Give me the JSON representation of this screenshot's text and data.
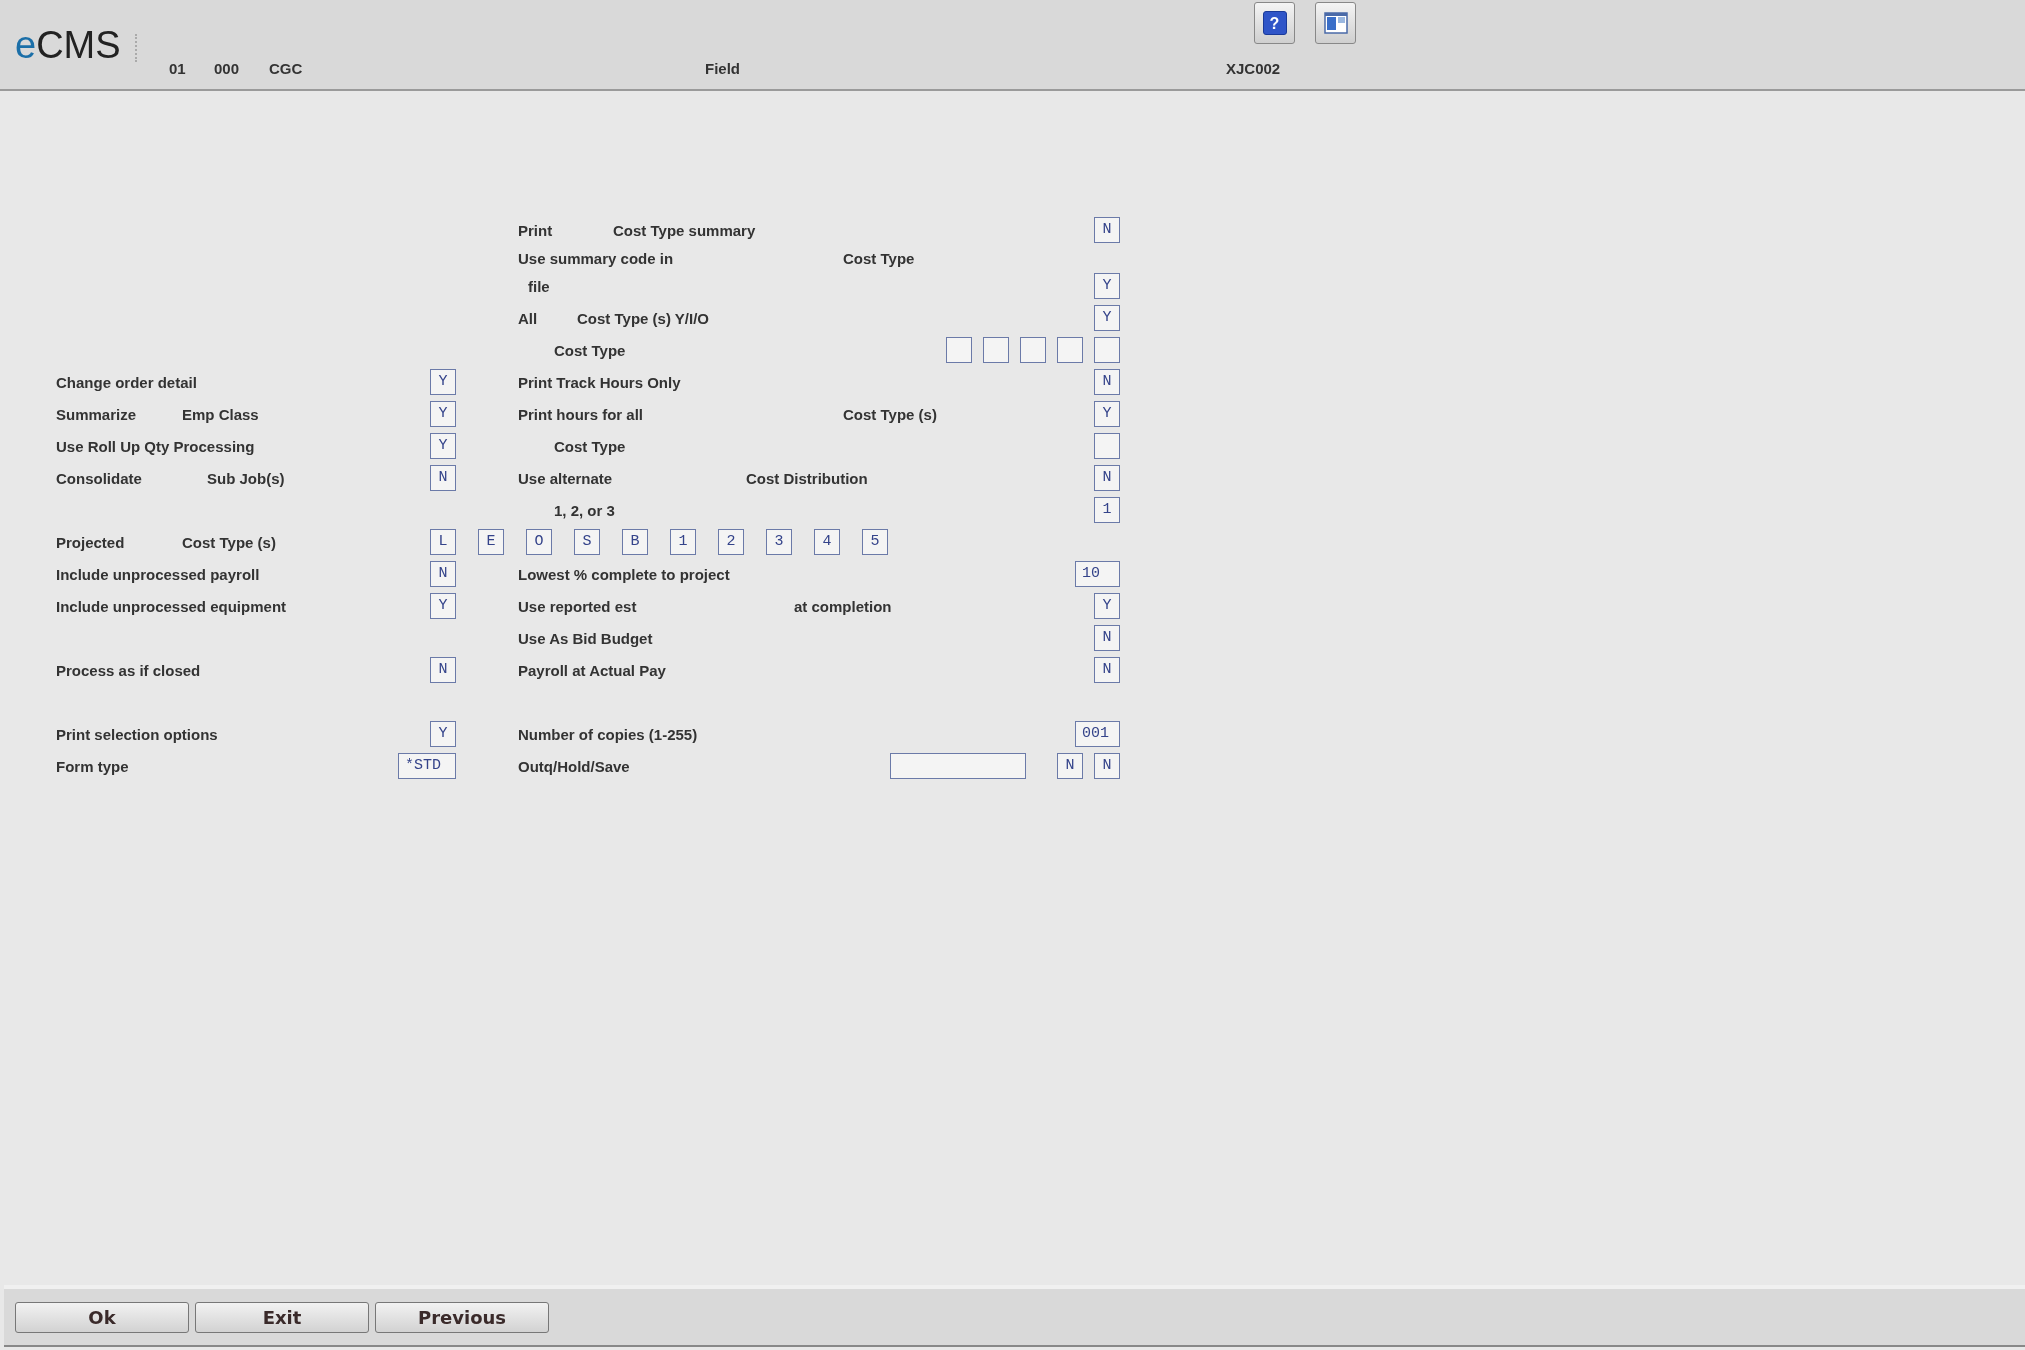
{
  "header": {
    "logo": "eCMS",
    "company": "01",
    "division": "000",
    "system": "CGC",
    "title": "Field",
    "program": "XJC002",
    "help_button": "?"
  },
  "rows": [
    {
      "right": {
        "parts": [
          "Print",
          "Cost Type summary"
        ],
        "fields": [
          {
            "kind": "flag",
            "value": "N"
          }
        ]
      }
    },
    {
      "right": {
        "parts": [
          "Use summary code in",
          "Cost Type"
        ]
      }
    },
    {
      "right": {
        "parts": [
          "file"
        ],
        "fields": [
          {
            "kind": "flag",
            "value": "Y"
          }
        ]
      }
    },
    {
      "right": {
        "parts": [
          "All",
          "Cost Type (s) Y/I/O"
        ],
        "fields": [
          {
            "kind": "flag",
            "value": "Y"
          }
        ]
      }
    },
    {
      "right": {
        "parts": [
          "Cost Type"
        ],
        "fields": [
          {
            "kind": "flag"
          },
          {
            "kind": "flag"
          },
          {
            "kind": "flag"
          },
          {
            "kind": "flag"
          },
          {
            "kind": "flag"
          }
        ]
      }
    },
    {
      "left": {
        "parts": [
          "Change order detail"
        ],
        "fields": [
          {
            "kind": "flag",
            "value": "Y"
          }
        ]
      },
      "right": {
        "parts": [
          "Print Track Hours Only"
        ],
        "fields": [
          {
            "kind": "flag",
            "value": "N"
          }
        ]
      }
    },
    {
      "left": {
        "parts": [
          "Summarize",
          "Emp Class"
        ],
        "fields": [
          {
            "kind": "flag",
            "value": "Y"
          }
        ]
      },
      "right": {
        "parts": [
          "Print hours for all",
          "Cost Type (s)"
        ],
        "fields": [
          {
            "kind": "flag",
            "value": "Y"
          }
        ]
      }
    },
    {
      "left": {
        "parts": [
          "Use Roll Up Qty Processing"
        ],
        "fields": [
          {
            "kind": "flag",
            "value": "Y"
          }
        ]
      },
      "right": {
        "parts": [
          "Cost Type"
        ],
        "fields": [
          {
            "kind": "flag"
          }
        ]
      }
    },
    {
      "left": {
        "parts": [
          "Consolidate",
          "Sub Job(s)"
        ],
        "fields": [
          {
            "kind": "flag",
            "value": "N"
          }
        ]
      },
      "right": {
        "parts": [
          "Use alternate",
          "Cost Distribution"
        ],
        "fields": [
          {
            "kind": "flag",
            "value": "N"
          }
        ]
      }
    },
    {
      "right": {
        "parts": [
          "1, 2, or 3"
        ],
        "fields": [
          {
            "kind": "flag",
            "value": "1"
          }
        ]
      }
    },
    {
      "left": {
        "parts": [
          "Projected",
          "Cost Type (s)"
        ],
        "fields": [
          {
            "kind": "flag",
            "value": "L"
          },
          {
            "kind": "flag",
            "value": "E"
          },
          {
            "kind": "flag",
            "value": "O"
          },
          {
            "kind": "flag",
            "value": "S"
          },
          {
            "kind": "flag",
            "value": "B"
          },
          {
            "kind": "flag",
            "value": "1"
          },
          {
            "kind": "flag",
            "value": "2"
          },
          {
            "kind": "flag",
            "value": "3"
          },
          {
            "kind": "flag",
            "value": "4"
          },
          {
            "kind": "flag",
            "value": "5"
          }
        ]
      }
    },
    {
      "left": {
        "parts": [
          "Include unprocessed payroll"
        ],
        "fields": [
          {
            "kind": "flag",
            "value": "N"
          }
        ]
      },
      "right": {
        "parts": [
          "Lowest % complete to project"
        ],
        "fields": [
          {
            "kind": "number",
            "value": "10"
          }
        ]
      }
    },
    {
      "left": {
        "parts": [
          "Include unprocessed equipment"
        ],
        "fields": [
          {
            "kind": "flag",
            "value": "Y"
          }
        ]
      },
      "right": {
        "parts": [
          "Use reported est",
          "at completion"
        ],
        "fields": [
          {
            "kind": "flag",
            "value": "Y"
          }
        ]
      }
    },
    {
      "right": {
        "parts": [
          "Use As Bid Budget"
        ],
        "fields": [
          {
            "kind": "flag",
            "value": "N"
          }
        ]
      }
    },
    {
      "left": {
        "parts": [
          "Process as if closed"
        ],
        "fields": [
          {
            "kind": "flag",
            "value": "N"
          }
        ]
      },
      "right": {
        "parts": [
          "Payroll at Actual Pay"
        ],
        "fields": [
          {
            "kind": "flag",
            "value": "N"
          }
        ]
      }
    },
    {},
    {
      "left": {
        "parts": [
          "Print selection options"
        ],
        "fields": [
          {
            "kind": "flag",
            "value": "Y"
          }
        ]
      },
      "right": {
        "parts": [
          "Number of copies (1-255)"
        ],
        "fields": [
          {
            "kind": "number",
            "value": "001"
          }
        ]
      }
    },
    {
      "left": {
        "parts": [
          "Form type"
        ],
        "fields": [
          {
            "kind": "name",
            "value": "*STD"
          }
        ]
      },
      "right": {
        "parts": [
          "Outq/Hold/Save"
        ],
        "fields": [
          {
            "kind": "name"
          },
          {
            "kind": "flag",
            "value": "N"
          },
          {
            "kind": "flag",
            "value": "N"
          }
        ]
      }
    }
  ],
  "buttons": [
    "Ok",
    "Exit",
    "Previous"
  ]
}
